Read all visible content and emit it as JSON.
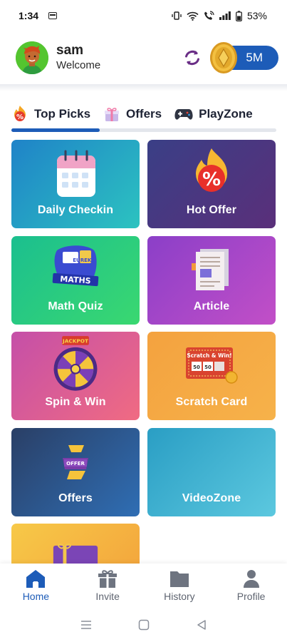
{
  "status_bar": {
    "time": "1:34",
    "battery": "53%"
  },
  "header": {
    "user_name": "sam",
    "greeting": "Welcome",
    "coin_balance": "5M"
  },
  "tabs": [
    {
      "label": "Top Picks",
      "icon": "percent-flame-icon",
      "active": true
    },
    {
      "label": "Offers",
      "icon": "gift-box-icon",
      "active": false
    },
    {
      "label": "PlayZone",
      "icon": "gamepad-icon",
      "active": false
    }
  ],
  "cards": [
    {
      "label": "Daily Checkin",
      "icon": "calendar-icon"
    },
    {
      "label": "Hot Offer",
      "icon": "percent-fire-icon"
    },
    {
      "label": "Math Quiz",
      "icon": "maths-badge-icon",
      "art_text": "MATHS",
      "art_subtext": "EUREKA"
    },
    {
      "label": "Article",
      "icon": "article-document-icon"
    },
    {
      "label": "Spin & Win",
      "icon": "jackpot-wheel-icon",
      "art_text": "JACKPOT"
    },
    {
      "label": "Scratch Card",
      "icon": "scratch-card-icon",
      "art_text": "Scratch & Win!",
      "art_cell_1": "50",
      "art_cell_2": "50"
    },
    {
      "label": "Offers",
      "icon": "offer-ticket-icon",
      "art_text": "OFFER"
    },
    {
      "label": "VideoZone",
      "icon": ""
    },
    {
      "label": "",
      "icon": "gift-card-icon"
    }
  ],
  "bottom_nav": [
    {
      "label": "Home",
      "icon": "home-icon",
      "active": true
    },
    {
      "label": "Invite",
      "icon": "gift-icon",
      "active": false
    },
    {
      "label": "History",
      "icon": "folder-icon",
      "active": false
    },
    {
      "label": "Profile",
      "icon": "person-icon",
      "active": false
    }
  ],
  "colors": {
    "primary": "#1d5cb8",
    "nav_inactive": "#5e6470"
  }
}
